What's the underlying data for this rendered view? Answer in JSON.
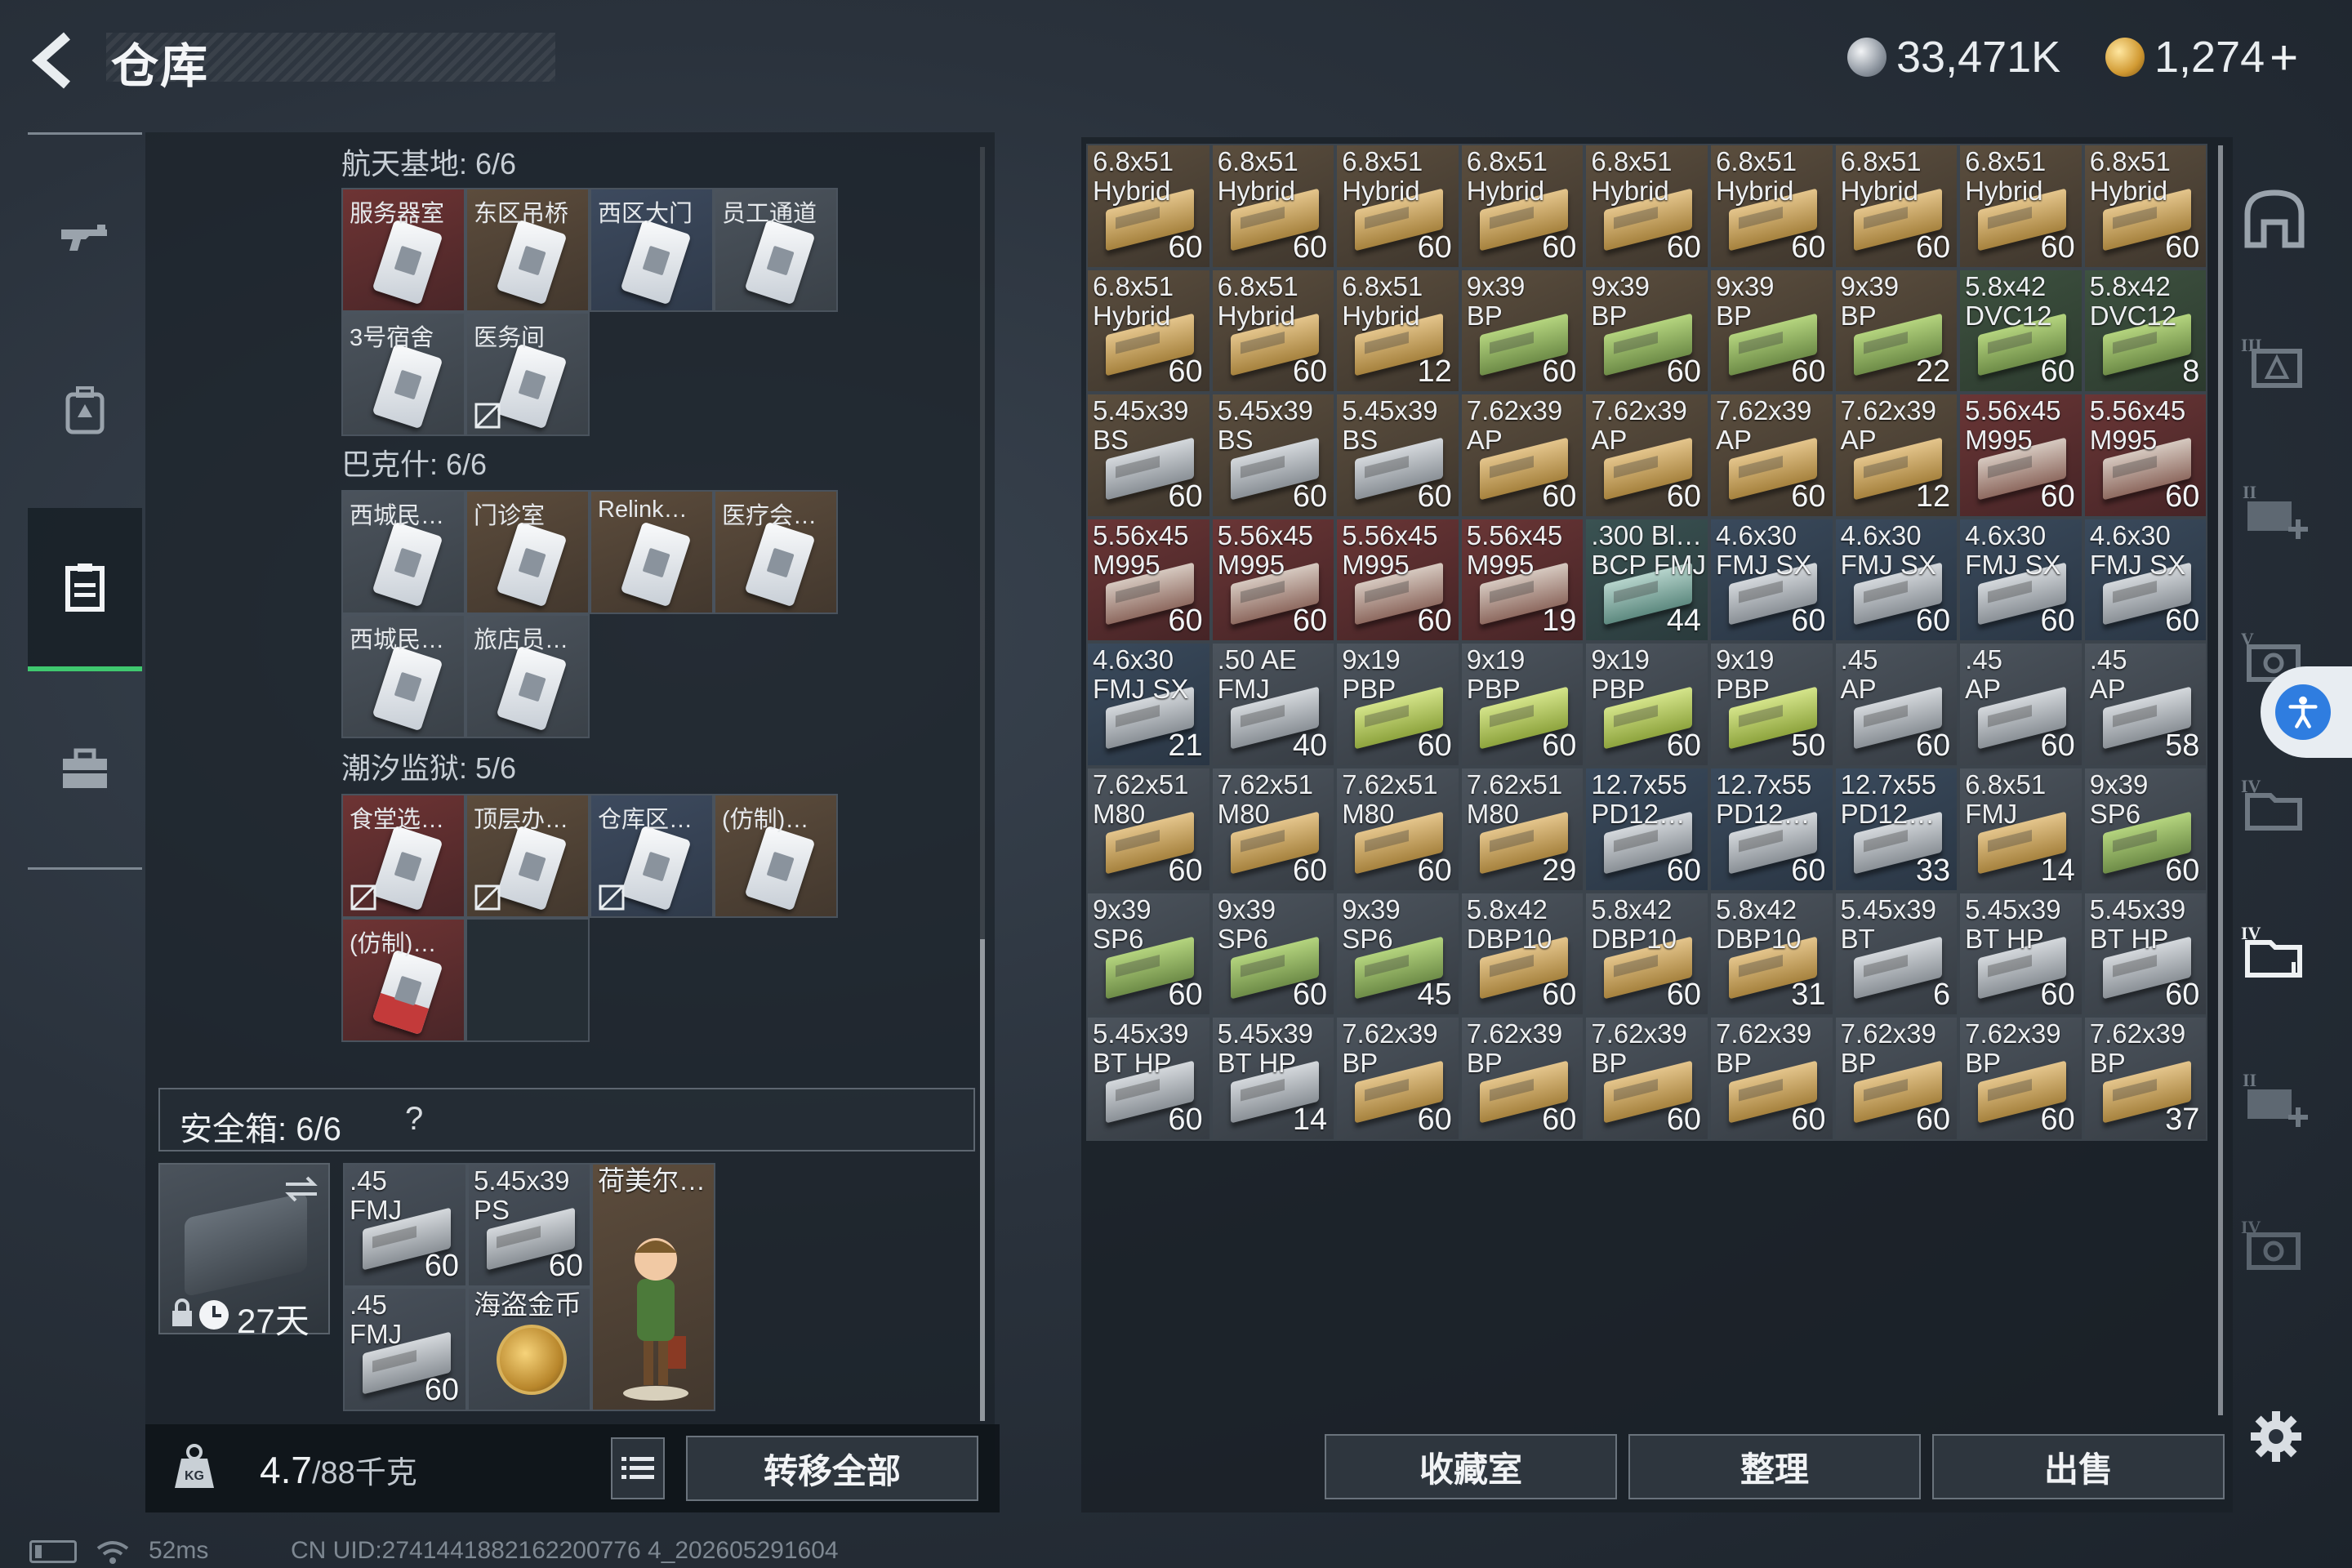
{
  "header": {
    "title": "仓库",
    "currencies": [
      {
        "icon": "silver-coin-icon",
        "value": "33,471K"
      },
      {
        "icon": "gold-coin-icon",
        "value": "1,274"
      }
    ],
    "plus_label": "+"
  },
  "left_nav": [
    "weapon-icon",
    "backpack-icon",
    "storage-icon",
    "briefcase-icon"
  ],
  "key_sections": [
    {
      "title": "航天基地: 6/6",
      "slots": [
        {
          "name": "服务器室",
          "color": "red",
          "broken": false
        },
        {
          "name": "东区吊桥",
          "color": "brown",
          "broken": false
        },
        {
          "name": "西区大门",
          "color": "blue",
          "broken": false
        },
        {
          "name": "员工通道",
          "color": "grey",
          "broken": false
        },
        {
          "name": "3号宿舍",
          "color": "grey",
          "broken": false
        },
        {
          "name": "医务间",
          "color": "grey",
          "broken": true
        }
      ]
    },
    {
      "title": "巴克什: 6/6",
      "slots": [
        {
          "name": "西城民…",
          "color": "grey",
          "broken": false
        },
        {
          "name": "门诊室",
          "color": "brown",
          "broken": false
        },
        {
          "name": "Relink…",
          "color": "brown",
          "broken": false
        },
        {
          "name": "医疗会…",
          "color": "brown",
          "broken": false
        },
        {
          "name": "西城民…",
          "color": "grey",
          "broken": false
        },
        {
          "name": "旅店员…",
          "color": "grey",
          "broken": false
        }
      ]
    },
    {
      "title": "潮汐监狱: 5/6",
      "slots": [
        {
          "name": "食堂选…",
          "color": "red",
          "broken": true
        },
        {
          "name": "顶层办…",
          "color": "brown",
          "broken": true
        },
        {
          "name": "仓库区…",
          "color": "blue",
          "broken": true
        },
        {
          "name": "(仿制)…",
          "color": "brown",
          "broken": false
        },
        {
          "name": "(仿制)…",
          "color": "red",
          "broken": false
        }
      ]
    }
  ],
  "safe_box": {
    "title": "安全箱: 6/6",
    "help": "?",
    "days": "27天",
    "items": [
      {
        "name": ".45\nFMJ",
        "count": "60",
        "kind": "ammo"
      },
      {
        "name": "5.45x39\nPS",
        "count": "60",
        "kind": "ammo"
      },
      {
        "name": "荷美尔…",
        "count": "",
        "kind": "figurine"
      },
      {
        "name": ".45\nFMJ",
        "count": "60",
        "kind": "ammo"
      },
      {
        "name": "海盗金币",
        "count": "",
        "kind": "coin"
      }
    ]
  },
  "bottom_left": {
    "weight": "4.7",
    "weight_max": "/88千克",
    "transfer_all": "转移全部"
  },
  "stash": [
    {
      "name": "6.8x51\nHybrid",
      "count": "60",
      "bg": "brown",
      "box": "tan"
    },
    {
      "name": "6.8x51\nHybrid",
      "count": "60",
      "bg": "brown",
      "box": "tan"
    },
    {
      "name": "6.8x51\nHybrid",
      "count": "60",
      "bg": "brown",
      "box": "tan"
    },
    {
      "name": "6.8x51\nHybrid",
      "count": "60",
      "bg": "brown",
      "box": "tan"
    },
    {
      "name": "6.8x51\nHybrid",
      "count": "60",
      "bg": "brown",
      "box": "tan"
    },
    {
      "name": "6.8x51\nHybrid",
      "count": "60",
      "bg": "brown",
      "box": "tan"
    },
    {
      "name": "6.8x51\nHybrid",
      "count": "60",
      "bg": "brown",
      "box": "tan"
    },
    {
      "name": "6.8x51\nHybrid",
      "count": "60",
      "bg": "brown",
      "box": "tan"
    },
    {
      "name": "6.8x51\nHybrid",
      "count": "60",
      "bg": "brown",
      "box": "tan"
    },
    {
      "name": "6.8x51\nHybrid",
      "count": "60",
      "bg": "brown",
      "box": "tan"
    },
    {
      "name": "6.8x51\nHybrid",
      "count": "60",
      "bg": "brown",
      "box": "tan"
    },
    {
      "name": "6.8x51\nHybrid",
      "count": "12",
      "bg": "brown",
      "box": "tan"
    },
    {
      "name": "9x39\nBP",
      "count": "60",
      "bg": "brown",
      "box": "green"
    },
    {
      "name": "9x39\nBP",
      "count": "60",
      "bg": "brown",
      "box": "green"
    },
    {
      "name": "9x39\nBP",
      "count": "60",
      "bg": "brown",
      "box": "green"
    },
    {
      "name": "9x39\nBP",
      "count": "22",
      "bg": "brown",
      "box": "green"
    },
    {
      "name": "5.8x42\nDVC12",
      "count": "60",
      "bg": "green",
      "box": "green"
    },
    {
      "name": "5.8x42\nDVC12",
      "count": "8",
      "bg": "green",
      "box": "green"
    },
    {
      "name": "5.45x39\nBS",
      "count": "60",
      "bg": "brown",
      "box": "grey"
    },
    {
      "name": "5.45x39\nBS",
      "count": "60",
      "bg": "brown",
      "box": "grey"
    },
    {
      "name": "5.45x39\nBS",
      "count": "60",
      "bg": "brown",
      "box": "grey"
    },
    {
      "name": "7.62x39\nAP",
      "count": "60",
      "bg": "brown",
      "box": "tan"
    },
    {
      "name": "7.62x39\nAP",
      "count": "60",
      "bg": "brown",
      "box": "tan"
    },
    {
      "name": "7.62x39\nAP",
      "count": "60",
      "bg": "brown",
      "box": "tan"
    },
    {
      "name": "7.62x39\nAP",
      "count": "12",
      "bg": "brown",
      "box": "tan"
    },
    {
      "name": "5.56x45\nM995",
      "count": "60",
      "bg": "red",
      "box": "red"
    },
    {
      "name": "5.56x45\nM995",
      "count": "60",
      "bg": "red",
      "box": "red"
    },
    {
      "name": "5.56x45\nM995",
      "count": "60",
      "bg": "red",
      "box": "red"
    },
    {
      "name": "5.56x45\nM995",
      "count": "60",
      "bg": "red",
      "box": "red"
    },
    {
      "name": "5.56x45\nM995",
      "count": "60",
      "bg": "red",
      "box": "red"
    },
    {
      "name": "5.56x45\nM995",
      "count": "19",
      "bg": "red",
      "box": "red"
    },
    {
      "name": ".300 Bl…\nBCP FMJ",
      "count": "44",
      "bg": "teal",
      "box": "teal"
    },
    {
      "name": "4.6x30\nFMJ SX",
      "count": "60",
      "bg": "blue",
      "box": "grey"
    },
    {
      "name": "4.6x30\nFMJ SX",
      "count": "60",
      "bg": "blue",
      "box": "grey"
    },
    {
      "name": "4.6x30\nFMJ SX",
      "count": "60",
      "bg": "blue",
      "box": "grey"
    },
    {
      "name": "4.6x30\nFMJ SX",
      "count": "60",
      "bg": "blue",
      "box": "grey"
    },
    {
      "name": "4.6x30\nFMJ SX",
      "count": "21",
      "bg": "blue",
      "box": "grey"
    },
    {
      "name": ".50 AE\nFMJ",
      "count": "40",
      "bg": "grey",
      "box": "grey"
    },
    {
      "name": "9x19\nPBP",
      "count": "60",
      "bg": "grey",
      "box": "yellowgreen"
    },
    {
      "name": "9x19\nPBP",
      "count": "60",
      "bg": "grey",
      "box": "yellowgreen"
    },
    {
      "name": "9x19\nPBP",
      "count": "60",
      "bg": "grey",
      "box": "yellowgreen"
    },
    {
      "name": "9x19\nPBP",
      "count": "50",
      "bg": "grey",
      "box": "yellowgreen"
    },
    {
      "name": ".45\nAP",
      "count": "60",
      "bg": "grey",
      "box": "grey"
    },
    {
      "name": ".45\nAP",
      "count": "60",
      "bg": "grey",
      "box": "grey"
    },
    {
      "name": ".45\nAP",
      "count": "58",
      "bg": "grey",
      "box": "grey"
    },
    {
      "name": "7.62x51\nM80",
      "count": "60",
      "bg": "grey",
      "box": "tan"
    },
    {
      "name": "7.62x51\nM80",
      "count": "60",
      "bg": "grey",
      "box": "tan"
    },
    {
      "name": "7.62x51\nM80",
      "count": "60",
      "bg": "grey",
      "box": "tan"
    },
    {
      "name": "7.62x51\nM80",
      "count": "29",
      "bg": "grey",
      "box": "tan"
    },
    {
      "name": "12.7x55\nPD12…",
      "count": "60",
      "bg": "blue",
      "box": "grey"
    },
    {
      "name": "12.7x55\nPD12…",
      "count": "60",
      "bg": "blue",
      "box": "grey"
    },
    {
      "name": "12.7x55\nPD12…",
      "count": "33",
      "bg": "blue",
      "box": "grey"
    },
    {
      "name": "6.8x51\nFMJ",
      "count": "14",
      "bg": "grey",
      "box": "tan"
    },
    {
      "name": "9x39\nSP6",
      "count": "60",
      "bg": "grey",
      "box": "green"
    },
    {
      "name": "9x39\nSP6",
      "count": "60",
      "bg": "grey",
      "box": "green"
    },
    {
      "name": "9x39\nSP6",
      "count": "60",
      "bg": "grey",
      "box": "green"
    },
    {
      "name": "9x39\nSP6",
      "count": "45",
      "bg": "grey",
      "box": "green"
    },
    {
      "name": "5.8x42\nDBP10",
      "count": "60",
      "bg": "grey",
      "box": "tan"
    },
    {
      "name": "5.8x42\nDBP10",
      "count": "60",
      "bg": "grey",
      "box": "tan"
    },
    {
      "name": "5.8x42\nDBP10",
      "count": "31",
      "bg": "grey",
      "box": "tan"
    },
    {
      "name": "5.45x39\nBT",
      "count": "6",
      "bg": "grey",
      "box": "grey"
    },
    {
      "name": "5.45x39\nBT HP",
      "count": "60",
      "bg": "grey",
      "box": "grey"
    },
    {
      "name": "5.45x39\nBT HP",
      "count": "60",
      "bg": "grey",
      "box": "grey"
    },
    {
      "name": "5.45x39\nBT HP",
      "count": "60",
      "bg": "grey",
      "box": "grey"
    },
    {
      "name": "5.45x39\nBT HP",
      "count": "14",
      "bg": "grey",
      "box": "grey"
    },
    {
      "name": "7.62x39\nBP",
      "count": "60",
      "bg": "grey",
      "box": "tan"
    },
    {
      "name": "7.62x39\nBP",
      "count": "60",
      "bg": "grey",
      "box": "tan"
    },
    {
      "name": "7.62x39\nBP",
      "count": "60",
      "bg": "grey",
      "box": "tan"
    },
    {
      "name": "7.62x39\nBP",
      "count": "60",
      "bg": "grey",
      "box": "tan"
    },
    {
      "name": "7.62x39\nBP",
      "count": "60",
      "bg": "grey",
      "box": "tan"
    },
    {
      "name": "7.62x39\nBP",
      "count": "60",
      "bg": "grey",
      "box": "tan"
    },
    {
      "name": "7.62x39\nBP",
      "count": "37",
      "bg": "grey",
      "box": "tan"
    }
  ],
  "bottom_right": {
    "collection": "收藏室",
    "sort": "整理",
    "sell": "出售"
  },
  "side_icons": [
    "home-icon",
    "stash-tab-iii-icon",
    "stash-tab-ii-add-icon",
    "stash-tab-v-icon",
    "stash-tab-iv-icon",
    "stash-tab-iv-active-icon",
    "stash-tab-ii-add-icon",
    "stash-tab-iv-locked-icon"
  ],
  "status_bar": {
    "ping": "52ms",
    "uid": "CN UID:2741441882162200776 4_202605291604"
  }
}
